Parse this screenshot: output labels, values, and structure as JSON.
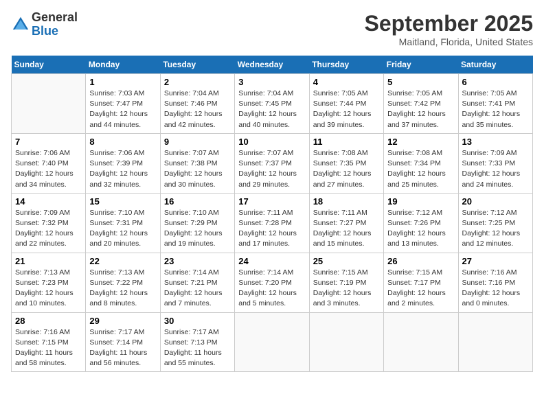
{
  "header": {
    "logo_line1": "General",
    "logo_line2": "Blue",
    "month": "September 2025",
    "location": "Maitland, Florida, United States"
  },
  "days_of_week": [
    "Sunday",
    "Monday",
    "Tuesday",
    "Wednesday",
    "Thursday",
    "Friday",
    "Saturday"
  ],
  "weeks": [
    [
      {
        "num": "",
        "info": ""
      },
      {
        "num": "1",
        "info": "Sunrise: 7:03 AM\nSunset: 7:47 PM\nDaylight: 12 hours\nand 44 minutes."
      },
      {
        "num": "2",
        "info": "Sunrise: 7:04 AM\nSunset: 7:46 PM\nDaylight: 12 hours\nand 42 minutes."
      },
      {
        "num": "3",
        "info": "Sunrise: 7:04 AM\nSunset: 7:45 PM\nDaylight: 12 hours\nand 40 minutes."
      },
      {
        "num": "4",
        "info": "Sunrise: 7:05 AM\nSunset: 7:44 PM\nDaylight: 12 hours\nand 39 minutes."
      },
      {
        "num": "5",
        "info": "Sunrise: 7:05 AM\nSunset: 7:42 PM\nDaylight: 12 hours\nand 37 minutes."
      },
      {
        "num": "6",
        "info": "Sunrise: 7:05 AM\nSunset: 7:41 PM\nDaylight: 12 hours\nand 35 minutes."
      }
    ],
    [
      {
        "num": "7",
        "info": "Sunrise: 7:06 AM\nSunset: 7:40 PM\nDaylight: 12 hours\nand 34 minutes."
      },
      {
        "num": "8",
        "info": "Sunrise: 7:06 AM\nSunset: 7:39 PM\nDaylight: 12 hours\nand 32 minutes."
      },
      {
        "num": "9",
        "info": "Sunrise: 7:07 AM\nSunset: 7:38 PM\nDaylight: 12 hours\nand 30 minutes."
      },
      {
        "num": "10",
        "info": "Sunrise: 7:07 AM\nSunset: 7:37 PM\nDaylight: 12 hours\nand 29 minutes."
      },
      {
        "num": "11",
        "info": "Sunrise: 7:08 AM\nSunset: 7:35 PM\nDaylight: 12 hours\nand 27 minutes."
      },
      {
        "num": "12",
        "info": "Sunrise: 7:08 AM\nSunset: 7:34 PM\nDaylight: 12 hours\nand 25 minutes."
      },
      {
        "num": "13",
        "info": "Sunrise: 7:09 AM\nSunset: 7:33 PM\nDaylight: 12 hours\nand 24 minutes."
      }
    ],
    [
      {
        "num": "14",
        "info": "Sunrise: 7:09 AM\nSunset: 7:32 PM\nDaylight: 12 hours\nand 22 minutes."
      },
      {
        "num": "15",
        "info": "Sunrise: 7:10 AM\nSunset: 7:31 PM\nDaylight: 12 hours\nand 20 minutes."
      },
      {
        "num": "16",
        "info": "Sunrise: 7:10 AM\nSunset: 7:29 PM\nDaylight: 12 hours\nand 19 minutes."
      },
      {
        "num": "17",
        "info": "Sunrise: 7:11 AM\nSunset: 7:28 PM\nDaylight: 12 hours\nand 17 minutes."
      },
      {
        "num": "18",
        "info": "Sunrise: 7:11 AM\nSunset: 7:27 PM\nDaylight: 12 hours\nand 15 minutes."
      },
      {
        "num": "19",
        "info": "Sunrise: 7:12 AM\nSunset: 7:26 PM\nDaylight: 12 hours\nand 13 minutes."
      },
      {
        "num": "20",
        "info": "Sunrise: 7:12 AM\nSunset: 7:25 PM\nDaylight: 12 hours\nand 12 minutes."
      }
    ],
    [
      {
        "num": "21",
        "info": "Sunrise: 7:13 AM\nSunset: 7:23 PM\nDaylight: 12 hours\nand 10 minutes."
      },
      {
        "num": "22",
        "info": "Sunrise: 7:13 AM\nSunset: 7:22 PM\nDaylight: 12 hours\nand 8 minutes."
      },
      {
        "num": "23",
        "info": "Sunrise: 7:14 AM\nSunset: 7:21 PM\nDaylight: 12 hours\nand 7 minutes."
      },
      {
        "num": "24",
        "info": "Sunrise: 7:14 AM\nSunset: 7:20 PM\nDaylight: 12 hours\nand 5 minutes."
      },
      {
        "num": "25",
        "info": "Sunrise: 7:15 AM\nSunset: 7:19 PM\nDaylight: 12 hours\nand 3 minutes."
      },
      {
        "num": "26",
        "info": "Sunrise: 7:15 AM\nSunset: 7:17 PM\nDaylight: 12 hours\nand 2 minutes."
      },
      {
        "num": "27",
        "info": "Sunrise: 7:16 AM\nSunset: 7:16 PM\nDaylight: 12 hours\nand 0 minutes."
      }
    ],
    [
      {
        "num": "28",
        "info": "Sunrise: 7:16 AM\nSunset: 7:15 PM\nDaylight: 11 hours\nand 58 minutes."
      },
      {
        "num": "29",
        "info": "Sunrise: 7:17 AM\nSunset: 7:14 PM\nDaylight: 11 hours\nand 56 minutes."
      },
      {
        "num": "30",
        "info": "Sunrise: 7:17 AM\nSunset: 7:13 PM\nDaylight: 11 hours\nand 55 minutes."
      },
      {
        "num": "",
        "info": ""
      },
      {
        "num": "",
        "info": ""
      },
      {
        "num": "",
        "info": ""
      },
      {
        "num": "",
        "info": ""
      }
    ]
  ]
}
